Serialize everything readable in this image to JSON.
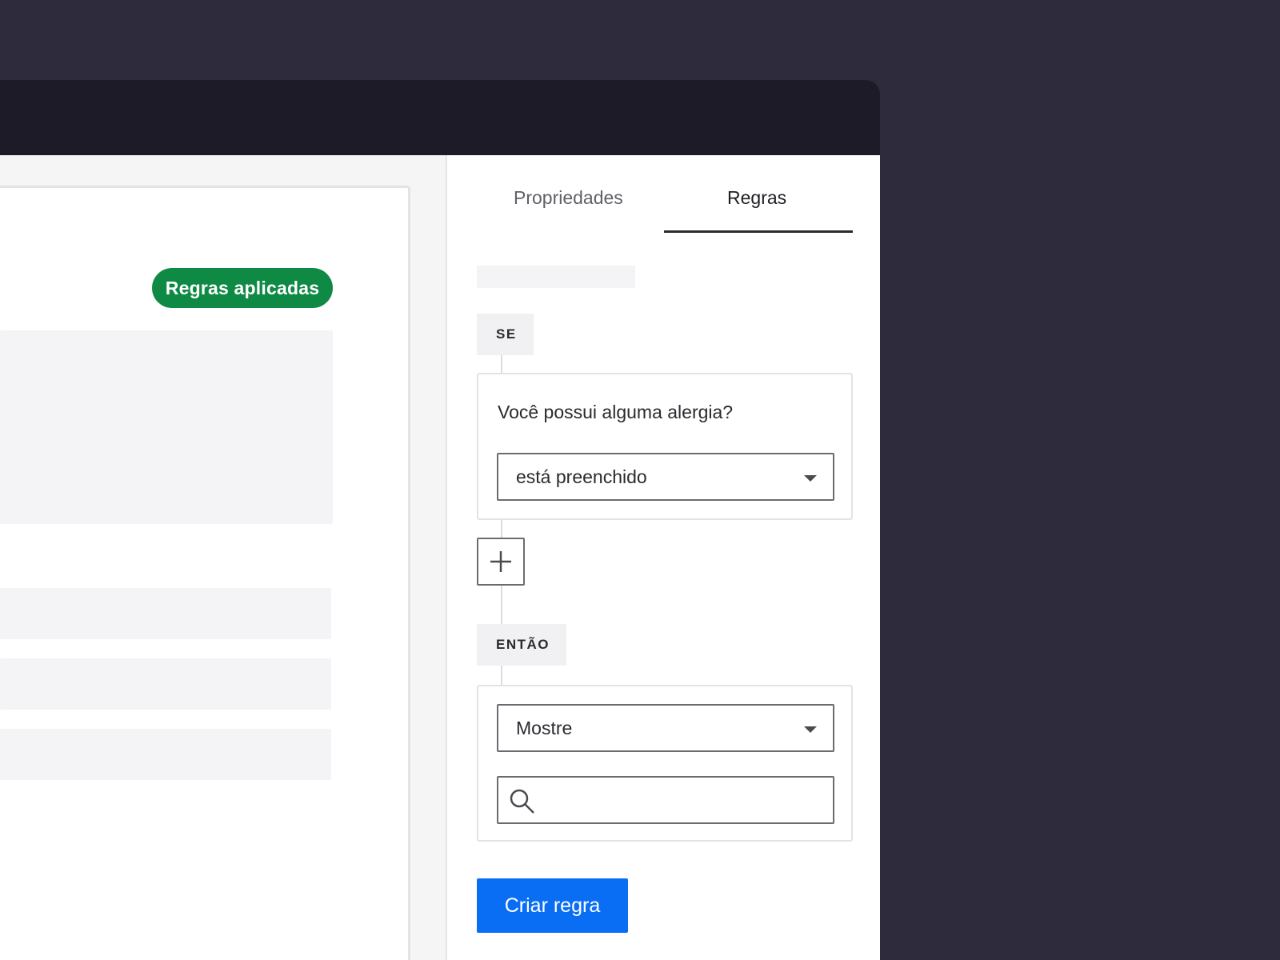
{
  "canvas": {
    "badge_label": "Regras aplicadas"
  },
  "panel": {
    "tabs": [
      {
        "label": "Propriedades",
        "active": false
      },
      {
        "label": "Regras",
        "active": true
      }
    ],
    "if_label": "SE",
    "condition": {
      "question": "Você possui alguma alergia?",
      "operator": "está preenchido"
    },
    "then_label": "ENTÃO",
    "action": {
      "value": "Mostre",
      "search_placeholder": ""
    },
    "create_button": "Criar regra"
  },
  "colors": {
    "badge": "#0f8a45",
    "primary_button": "#0a6ef5",
    "background": "#2d2b3c",
    "topbar": "#1c1b27"
  }
}
